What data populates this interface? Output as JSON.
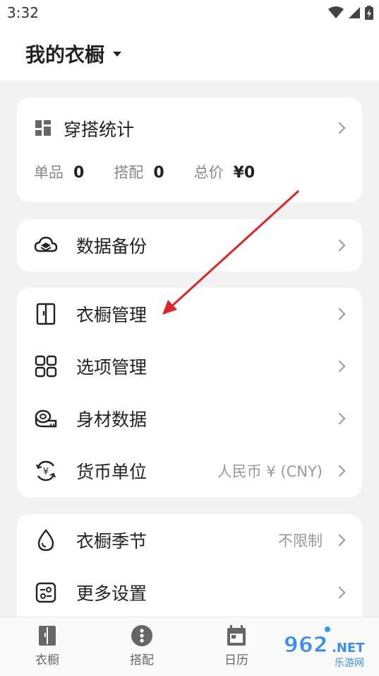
{
  "status_bar": {
    "time": "3:32"
  },
  "header": {
    "title": "我的衣橱"
  },
  "stats_card": {
    "title": "穿搭统计",
    "items_label": "单品",
    "items_value": "0",
    "outfits_label": "搭配",
    "outfits_value": "0",
    "total_label": "总价",
    "total_value": "¥0"
  },
  "backup_card": {
    "label": "数据备份"
  },
  "manage_card": {
    "wardrobe_manage": "衣橱管理",
    "option_manage": "选项管理",
    "body_data": "身材数据",
    "currency_label": "货币单位",
    "currency_value": "人民币 ¥ (CNY)"
  },
  "settings_card": {
    "season_label": "衣橱季节",
    "season_value": "不限制",
    "more_settings": "更多设置"
  },
  "bottom_nav": {
    "wardrobe": "衣橱",
    "outfit": "搭配",
    "calendar": "日历"
  },
  "watermark": {
    "text": "962",
    "suffix": ".NET",
    "sub": "乐游网"
  },
  "colors": {
    "annotation_arrow": "#d9262c",
    "accent": "#3399ff"
  },
  "icons": [
    "wifi-icon",
    "signal-icon",
    "battery-icon",
    "dashboard-icon",
    "cloud-backup-icon",
    "wardrobe-icon",
    "grid-icon",
    "tape-measure-icon",
    "currency-exchange-icon",
    "water-drop-icon",
    "settings-panel-icon",
    "chevron-right-icon"
  ]
}
